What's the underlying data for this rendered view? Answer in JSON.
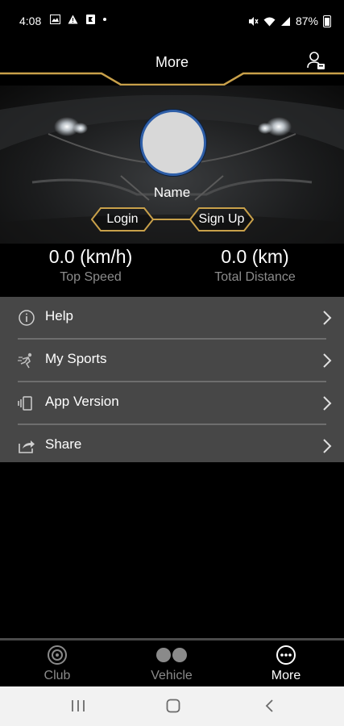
{
  "status_bar": {
    "time": "4:08",
    "battery_percent": "87%",
    "icons": [
      "gallery-icon",
      "warning-icon",
      "app-icon",
      "dot-icon",
      "mute-icon",
      "wifi-icon",
      "signal-icon",
      "battery-icon"
    ]
  },
  "header": {
    "title": "More",
    "accent_color": "#c8a04a"
  },
  "profile": {
    "name": "Name",
    "login_label": "Login",
    "signup_label": "Sign Up",
    "avatar_border_color": "#2f5fa8"
  },
  "stats": {
    "top_speed_value": "0.0 (km/h)",
    "top_speed_label": "Top Speed",
    "total_distance_value": "0.0 (km)",
    "total_distance_label": "Total Distance"
  },
  "menu": {
    "items": [
      {
        "label": "Help",
        "icon": "info-icon"
      },
      {
        "label": "My Sports",
        "icon": "sports-icon"
      },
      {
        "label": "App Version",
        "icon": "version-icon"
      },
      {
        "label": "Share",
        "icon": "share-icon"
      }
    ]
  },
  "bottom_nav": {
    "tabs": [
      {
        "label": "Club",
        "icon": "club-icon",
        "active": false
      },
      {
        "label": "Vehicle",
        "icon": "vehicle-icon",
        "active": false
      },
      {
        "label": "More",
        "icon": "more-icon",
        "active": true
      }
    ],
    "active_color": "#ffffff",
    "inactive_color": "#8a8a8a"
  },
  "system_nav": {
    "buttons": [
      "recents-icon",
      "home-icon",
      "back-icon"
    ]
  }
}
